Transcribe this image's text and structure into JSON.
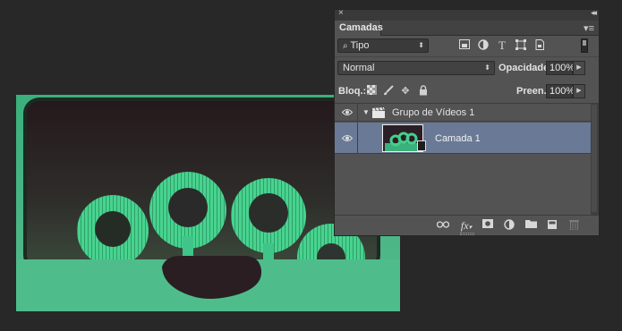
{
  "colors": {
    "panel_bg": "#535353",
    "selected_row": "#6a7996",
    "app_bg": "#282828",
    "photo_green": "#3fc48a"
  },
  "panel": {
    "close_icon": "close-icon",
    "collapse_icon": "double-chevron-icon",
    "tab_label": "Camadas",
    "menu_icon": "panel-menu-icon"
  },
  "filter": {
    "kind_label": "Tipo",
    "search_icon": "search-icon",
    "icons": [
      "pixel-filter-icon",
      "adjustment-filter-icon",
      "type-filter-icon",
      "shape-filter-icon",
      "smart-object-filter-icon"
    ]
  },
  "blend": {
    "mode": "Normal",
    "opacity_label": "Opacidade:",
    "opacity_value": "100%"
  },
  "lock": {
    "label": "Bloq.:",
    "fill_label": "Preen.:",
    "fill_value": "100%"
  },
  "layers": [
    {
      "name": "Grupo de Vídeos 1",
      "type": "video-group",
      "expanded": true,
      "visible": true,
      "selected": false
    },
    {
      "name": "Camada 1",
      "type": "video-layer",
      "visible": true,
      "selected": true
    }
  ],
  "footer_icons": [
    "link-layers-icon",
    "fx-icon",
    "mask-icon",
    "adjustment-layer-icon",
    "group-folder-icon",
    "new-layer-icon",
    "trash-icon"
  ],
  "footer": {
    "fx_text": "fx"
  }
}
